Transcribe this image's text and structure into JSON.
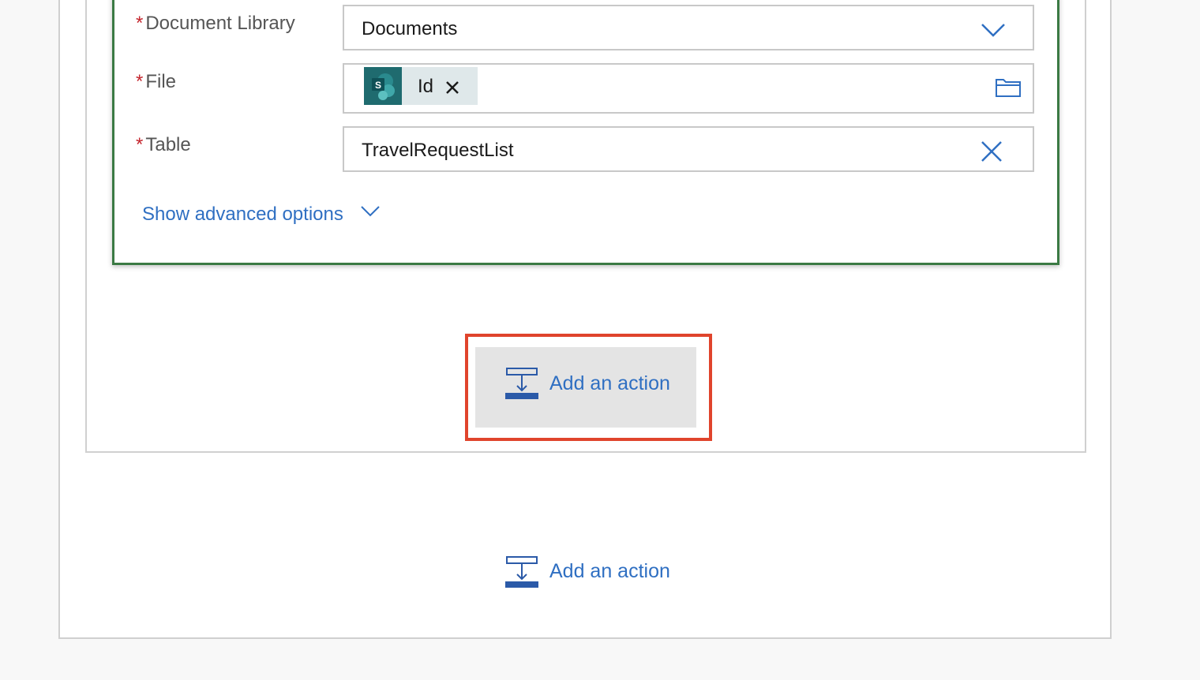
{
  "action_card": {
    "fields": [
      {
        "label": "Document Library",
        "required": true,
        "value": "Documents",
        "control": "dropdown"
      },
      {
        "label": "File",
        "required": true,
        "token": {
          "label": "Id",
          "icon": "sharepoint-icon"
        },
        "control": "file-picker"
      },
      {
        "label": "Table",
        "required": true,
        "value": "TravelRequestList",
        "control": "clearable-input"
      }
    ],
    "required_marker": "*",
    "advanced_options_label": "Show advanced options"
  },
  "add_action": {
    "highlighted_label": "Add an action",
    "outer_label": "Add an action"
  },
  "colors": {
    "accent_blue": "#2f6fc2",
    "card_border_green": "#3b7a44",
    "highlight_red": "#e0442c",
    "required_red": "#c4262e",
    "sharepoint_teal": "#1f6b6f"
  }
}
